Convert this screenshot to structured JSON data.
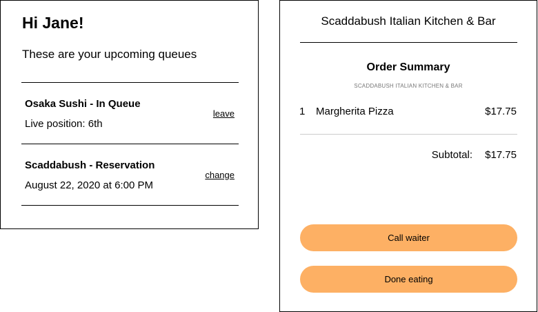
{
  "queues": {
    "greeting": "Hi Jane!",
    "subtitle": "These are your upcoming queues",
    "items": [
      {
        "name": "Osaka Sushi - In Queue",
        "detail": "Live position: 6th",
        "action": "leave"
      },
      {
        "name": "Scaddabush - Reservation",
        "detail": "August 22, 2020 at 6:00 PM",
        "action": "change"
      }
    ]
  },
  "order": {
    "restaurant_title": "Scaddabush Italian Kitchen & Bar",
    "summary_title": "Order Summary",
    "summary_subtitle": "SCADDABUSH ITALIAN KITCHEN & BAR",
    "items": [
      {
        "qty": "1",
        "name": "Margherita Pizza",
        "price": "$17.75"
      }
    ],
    "subtotal_label": "Subtotal:",
    "subtotal_value": "$17.75",
    "buttons": {
      "call_waiter": "Call waiter",
      "done_eating": "Done eating"
    }
  },
  "colors": {
    "button_bg": "#FDB064",
    "border": "#000000",
    "divider_light": "#CCCCCC"
  }
}
